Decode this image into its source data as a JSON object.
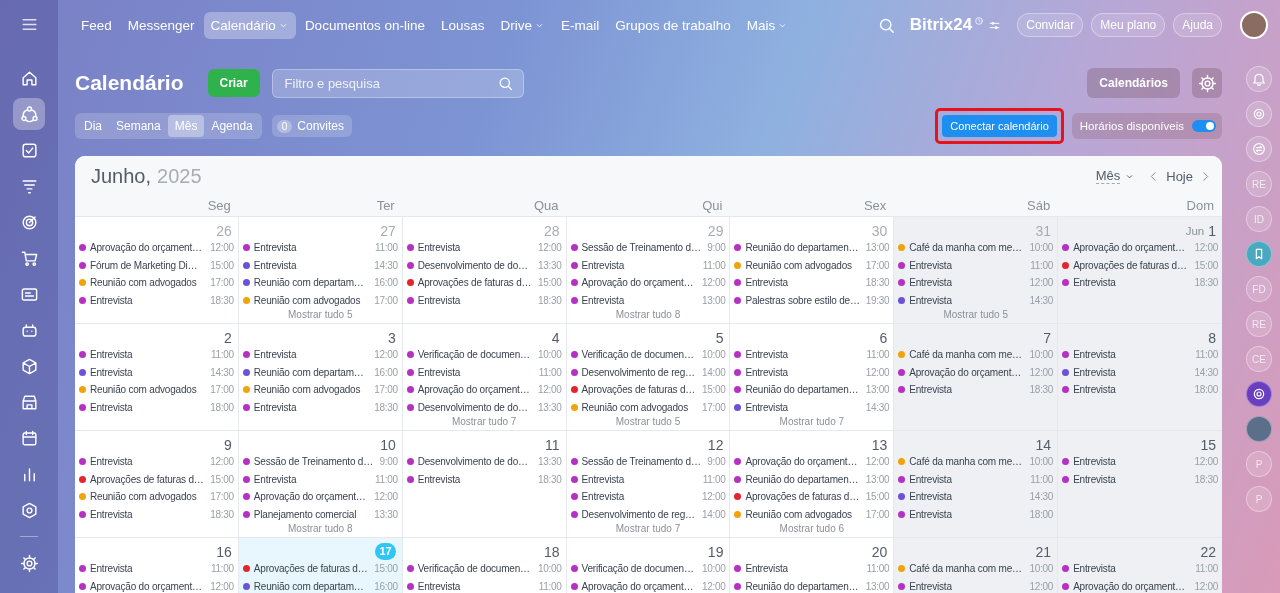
{
  "sidebar": {
    "items": [
      {
        "selected": false
      },
      {
        "selected": true
      },
      {
        "selected": false
      },
      {
        "selected": false
      },
      {
        "selected": false
      },
      {
        "selected": false
      },
      {
        "selected": false
      },
      {
        "selected": false
      },
      {
        "selected": false
      },
      {
        "selected": false
      },
      {
        "selected": false
      },
      {
        "selected": false
      },
      {
        "selected": false
      }
    ],
    "footer_items": [
      {
        "selected": false
      }
    ]
  },
  "nav": {
    "items": [
      {
        "label": "Feed",
        "selected": false,
        "dropdown": false
      },
      {
        "label": "Messenger",
        "selected": false,
        "dropdown": false
      },
      {
        "label": "Calendário",
        "selected": true,
        "dropdown": true
      },
      {
        "label": "Documentos on-line",
        "selected": false,
        "dropdown": false
      },
      {
        "label": "Lousas",
        "selected": false,
        "dropdown": false
      },
      {
        "label": "Drive",
        "selected": false,
        "dropdown": true
      },
      {
        "label": "E-mail",
        "selected": false,
        "dropdown": false
      },
      {
        "label": "Grupos de trabalho",
        "selected": false,
        "dropdown": false
      },
      {
        "label": "Mais",
        "selected": false,
        "dropdown": true
      }
    ],
    "logo": "Bitrix24",
    "buttons": [
      "Convidar",
      "Meu plano",
      "Ajuda"
    ]
  },
  "page": {
    "title": "Calendário",
    "create_button": "Criar",
    "search": {
      "placeholder": "Filtro e pesquisa"
    },
    "calendars_button": "Calendários",
    "views": [
      {
        "label": "Dia",
        "selected": false
      },
      {
        "label": "Semana",
        "selected": false
      },
      {
        "label": "Mês",
        "selected": true
      },
      {
        "label": "Agenda",
        "selected": false
      }
    ],
    "invites": {
      "count": "0",
      "label": "Convites"
    },
    "connect_button": {
      "label": "Conectar calendário",
      "highlighted": true
    },
    "availability": {
      "label": "Horários disponíveis",
      "on": true
    }
  },
  "calendar": {
    "month": "Junho,",
    "year": "2025",
    "view_select": "Mês",
    "today_button": "Hoje",
    "columns": [
      {
        "label": "Seg",
        "weekend": false
      },
      {
        "label": "Ter",
        "weekend": false
      },
      {
        "label": "Qua",
        "weekend": false
      },
      {
        "label": "Qui",
        "weekend": false
      },
      {
        "label": "Sex",
        "weekend": false
      },
      {
        "label": "Sáb",
        "weekend": true
      },
      {
        "label": "Dom",
        "weekend": true
      }
    ],
    "weeks": [
      {
        "days": [
          {
            "day": "26",
            "other_month": true,
            "today": false,
            "events": [
              {
                "title": "Aprovação do orçament…",
                "time": "12:00",
                "color": "#b531c3"
              },
              {
                "title": "Fórum de Marketing Di…",
                "time": "15:00",
                "color": "#b531c3"
              },
              {
                "title": "Reunião com advogados",
                "time": "17:00",
                "color": "#f0a30a"
              },
              {
                "title": "Entrevista",
                "time": "18:30",
                "color": "#b531c3"
              }
            ]
          },
          {
            "day": "27",
            "other_month": true,
            "today": false,
            "events": [
              {
                "title": "Entrevista",
                "time": "11:00",
                "color": "#b531c3"
              },
              {
                "title": "Entrevista",
                "time": "14:30",
                "color": "#6b52d9"
              },
              {
                "title": "Reunião com departam…",
                "time": "16:00",
                "color": "#6b52d9"
              },
              {
                "title": "Reunião com advogados",
                "time": "17:00",
                "color": "#f0a30a"
              }
            ],
            "more": "Mostrar tudo 5"
          },
          {
            "day": "28",
            "other_month": true,
            "today": false,
            "events": [
              {
                "title": "Entrevista",
                "time": "12:00",
                "color": "#b531c3"
              },
              {
                "title": "Desenvolvimento de do…",
                "time": "13:30",
                "color": "#b531c3"
              },
              {
                "title": "Aprovações de faturas d…",
                "time": "15:00",
                "color": "#e3262b"
              },
              {
                "title": "Entrevista",
                "time": "18:30",
                "color": "#b531c3"
              }
            ]
          },
          {
            "day": "29",
            "other_month": true,
            "today": false,
            "events": [
              {
                "title": "Sessão de Treinamento d…",
                "time": "9:00",
                "color": "#b531c3"
              },
              {
                "title": "Entrevista",
                "time": "11:00",
                "color": "#b531c3"
              },
              {
                "title": "Aprovação do orçament…",
                "time": "12:00",
                "color": "#b531c3"
              },
              {
                "title": "Entrevista",
                "time": "13:00",
                "color": "#b531c3"
              }
            ],
            "more": "Mostrar tudo 8"
          },
          {
            "day": "30",
            "other_month": true,
            "today": false,
            "events": [
              {
                "title": "Reunião do departamen…",
                "time": "13:00",
                "color": "#b531c3"
              },
              {
                "title": "Reunião com advogados",
                "time": "17:00",
                "color": "#f0a30a"
              },
              {
                "title": "Entrevista",
                "time": "18:30",
                "color": "#b531c3"
              },
              {
                "title": "Palestras sobre estilo de…",
                "time": "19:30",
                "color": "#b531c3"
              }
            ]
          },
          {
            "day": "31",
            "other_month": true,
            "today": false,
            "events": [
              {
                "title": "Café da manha com me…",
                "time": "10:00",
                "color": "#f0a30a"
              },
              {
                "title": "Entrevista",
                "time": "11:00",
                "color": "#b531c3"
              },
              {
                "title": "Entrevista",
                "time": "12:00",
                "color": "#b531c3"
              },
              {
                "title": "Entrevista",
                "time": "14:30",
                "color": "#6b52d9"
              }
            ],
            "more": "Mostrar tudo 5"
          },
          {
            "month_label": "Jun",
            "day": "1",
            "other_month": false,
            "today": false,
            "events": [
              {
                "title": "Aprovação do orçament…",
                "time": "12:00",
                "color": "#b531c3"
              },
              {
                "title": "Aprovações de faturas d…",
                "time": "15:00",
                "color": "#e3262b"
              },
              {
                "title": "Entrevista",
                "time": "18:30",
                "color": "#b531c3"
              }
            ]
          }
        ]
      },
      {
        "days": [
          {
            "day": "2",
            "other_month": false,
            "today": false,
            "events": [
              {
                "title": "Entrevista",
                "time": "11:00",
                "color": "#b531c3"
              },
              {
                "title": "Entrevista",
                "time": "14:30",
                "color": "#6b52d9"
              },
              {
                "title": "Reunião com advogados",
                "time": "17:00",
                "color": "#f0a30a"
              },
              {
                "title": "Entrevista",
                "time": "18:00",
                "color": "#b531c3"
              }
            ]
          },
          {
            "day": "3",
            "other_month": false,
            "today": false,
            "events": [
              {
                "title": "Entrevista",
                "time": "12:00",
                "color": "#b531c3"
              },
              {
                "title": "Reunião com departam…",
                "time": "16:00",
                "color": "#6b52d9"
              },
              {
                "title": "Reunião com advogados",
                "time": "17:00",
                "color": "#f0a30a"
              },
              {
                "title": "Entrevista",
                "time": "18:30",
                "color": "#b531c3"
              }
            ]
          },
          {
            "day": "4",
            "other_month": false,
            "today": false,
            "events": [
              {
                "title": "Verificação de documen…",
                "time": "10:00",
                "color": "#b531c3"
              },
              {
                "title": "Entrevista",
                "time": "11:00",
                "color": "#b531c3"
              },
              {
                "title": "Aprovação do orçament…",
                "time": "12:00",
                "color": "#b531c3"
              },
              {
                "title": "Desenvolvimento de do…",
                "time": "13:30",
                "color": "#b531c3"
              }
            ],
            "more": "Mostrar tudo 7"
          },
          {
            "day": "5",
            "other_month": false,
            "today": false,
            "events": [
              {
                "title": "Verificação de documen…",
                "time": "10:00",
                "color": "#b531c3"
              },
              {
                "title": "Desenvolvimento de reg…",
                "time": "14:00",
                "color": "#b531c3"
              },
              {
                "title": "Aprovações de faturas d…",
                "time": "15:00",
                "color": "#e3262b"
              },
              {
                "title": "Reunião com advogados",
                "time": "17:00",
                "color": "#f0a30a"
              }
            ],
            "more": "Mostrar tudo 5"
          },
          {
            "day": "6",
            "other_month": false,
            "today": false,
            "events": [
              {
                "title": "Entrevista",
                "time": "11:00",
                "color": "#b531c3"
              },
              {
                "title": "Entrevista",
                "time": "12:00",
                "color": "#b531c3"
              },
              {
                "title": "Reunião do departamen…",
                "time": "13:00",
                "color": "#b531c3"
              },
              {
                "title": "Entrevista",
                "time": "14:30",
                "color": "#6b52d9"
              }
            ],
            "more": "Mostrar tudo 7"
          },
          {
            "day": "7",
            "other_month": false,
            "today": false,
            "events": [
              {
                "title": "Café da manha com me…",
                "time": "10:00",
                "color": "#f0a30a"
              },
              {
                "title": "Aprovação do orçament…",
                "time": "12:00",
                "color": "#b531c3"
              },
              {
                "title": "Entrevista",
                "time": "18:30",
                "color": "#b531c3"
              }
            ]
          },
          {
            "day": "8",
            "other_month": false,
            "today": false,
            "events": [
              {
                "title": "Entrevista",
                "time": "11:00",
                "color": "#b531c3"
              },
              {
                "title": "Entrevista",
                "time": "14:30",
                "color": "#6b52d9"
              },
              {
                "title": "Entrevista",
                "time": "18:00",
                "color": "#b531c3"
              }
            ]
          }
        ]
      },
      {
        "days": [
          {
            "day": "9",
            "other_month": false,
            "today": false,
            "events": [
              {
                "title": "Entrevista",
                "time": "12:00",
                "color": "#b531c3"
              },
              {
                "title": "Aprovações de faturas d…",
                "time": "15:00",
                "color": "#e3262b"
              },
              {
                "title": "Reunião com advogados",
                "time": "17:00",
                "color": "#f0a30a"
              },
              {
                "title": "Entrevista",
                "time": "18:30",
                "color": "#b531c3"
              }
            ]
          },
          {
            "day": "10",
            "other_month": false,
            "today": false,
            "events": [
              {
                "title": "Sessão de Treinamento d…",
                "time": "9:00",
                "color": "#b531c3"
              },
              {
                "title": "Entrevista",
                "time": "11:00",
                "color": "#b531c3"
              },
              {
                "title": "Aprovação do orçament…",
                "time": "12:00",
                "color": "#b531c3"
              },
              {
                "title": "Planejamento comercial",
                "time": "13:30",
                "color": "#b531c3"
              }
            ],
            "more": "Mostrar tudo 8"
          },
          {
            "day": "11",
            "other_month": false,
            "today": false,
            "events": [
              {
                "title": "Desenvolvimento de do…",
                "time": "13:30",
                "color": "#b531c3"
              },
              {
                "title": "Entrevista",
                "time": "18:30",
                "color": "#b531c3"
              }
            ]
          },
          {
            "day": "12",
            "other_month": false,
            "today": false,
            "events": [
              {
                "title": "Sessão de Treinamento d…",
                "time": "9:00",
                "color": "#b531c3"
              },
              {
                "title": "Entrevista",
                "time": "11:00",
                "color": "#b531c3"
              },
              {
                "title": "Entrevista",
                "time": "12:00",
                "color": "#b531c3"
              },
              {
                "title": "Desenvolvimento de reg…",
                "time": "14:00",
                "color": "#b531c3"
              }
            ],
            "more": "Mostrar tudo 7"
          },
          {
            "day": "13",
            "other_month": false,
            "today": false,
            "events": [
              {
                "title": "Aprovação do orçament…",
                "time": "12:00",
                "color": "#b531c3"
              },
              {
                "title": "Reunião do departamen…",
                "time": "13:00",
                "color": "#b531c3"
              },
              {
                "title": "Aprovações de faturas d…",
                "time": "15:00",
                "color": "#e3262b"
              },
              {
                "title": "Reunião com advogados",
                "time": "17:00",
                "color": "#f0a30a"
              }
            ],
            "more": "Mostrar tudo 6"
          },
          {
            "day": "14",
            "other_month": false,
            "today": false,
            "events": [
              {
                "title": "Café da manha com me…",
                "time": "10:00",
                "color": "#f0a30a"
              },
              {
                "title": "Entrevista",
                "time": "11:00",
                "color": "#b531c3"
              },
              {
                "title": "Entrevista",
                "time": "14:30",
                "color": "#6b52d9"
              },
              {
                "title": "Entrevista",
                "time": "18:00",
                "color": "#b531c3"
              }
            ]
          },
          {
            "day": "15",
            "other_month": false,
            "today": false,
            "events": [
              {
                "title": "Entrevista",
                "time": "12:00",
                "color": "#b531c3"
              },
              {
                "title": "Entrevista",
                "time": "18:30",
                "color": "#b531c3"
              }
            ]
          }
        ]
      },
      {
        "days": [
          {
            "day": "16",
            "other_month": false,
            "today": false,
            "events": [
              {
                "title": "Entrevista",
                "time": "11:00",
                "color": "#b531c3"
              },
              {
                "title": "Aprovação do orçament…",
                "time": "12:00",
                "color": "#b531c3"
              }
            ]
          },
          {
            "day": "17",
            "other_month": false,
            "today": true,
            "events": [
              {
                "title": "Aprovações de faturas d…",
                "time": "15:00",
                "color": "#e3262b"
              },
              {
                "title": "Reunião com departam…",
                "time": "16:00",
                "color": "#6b52d9"
              }
            ]
          },
          {
            "day": "18",
            "other_month": false,
            "today": false,
            "events": [
              {
                "title": "Verificação de documen…",
                "time": "10:00",
                "color": "#b531c3"
              },
              {
                "title": "Entrevista",
                "time": "11:00",
                "color": "#b531c3"
              }
            ]
          },
          {
            "day": "19",
            "other_month": false,
            "today": false,
            "events": [
              {
                "title": "Verificação de documen…",
                "time": "10:00",
                "color": "#b531c3"
              },
              {
                "title": "Aprovação do orçament…",
                "time": "12:00",
                "color": "#b531c3"
              }
            ]
          },
          {
            "day": "20",
            "other_month": false,
            "today": false,
            "events": [
              {
                "title": "Entrevista",
                "time": "11:00",
                "color": "#b531c3"
              },
              {
                "title": "Reunião do departamen…",
                "time": "13:00",
                "color": "#b531c3"
              }
            ]
          },
          {
            "day": "21",
            "other_month": false,
            "today": false,
            "events": [
              {
                "title": "Café da manha com me…",
                "time": "10:00",
                "color": "#f0a30a"
              },
              {
                "title": "Entrevista",
                "time": "12:00",
                "color": "#b531c3"
              }
            ]
          },
          {
            "day": "22",
            "other_month": false,
            "today": false,
            "events": [
              {
                "title": "Entrevista",
                "time": "11:00",
                "color": "#b531c3"
              },
              {
                "title": "Aprovação do orçament…",
                "time": "12:00",
                "color": "#b531c3"
              }
            ]
          }
        ]
      }
    ]
  },
  "right_rail": [
    {
      "kind": "icon"
    },
    {
      "kind": "icon"
    },
    {
      "kind": "icon"
    },
    {
      "kind": "initials",
      "text": "RE"
    },
    {
      "kind": "initials",
      "text": "ID"
    },
    {
      "kind": "icon"
    },
    {
      "kind": "initials",
      "text": "FD"
    },
    {
      "kind": "initials",
      "text": "RE"
    },
    {
      "kind": "initials",
      "text": "CE"
    },
    {
      "kind": "icon"
    },
    {
      "kind": "photo"
    },
    {
      "kind": "initials",
      "text": "P"
    },
    {
      "kind": "initials",
      "text": "P"
    }
  ]
}
